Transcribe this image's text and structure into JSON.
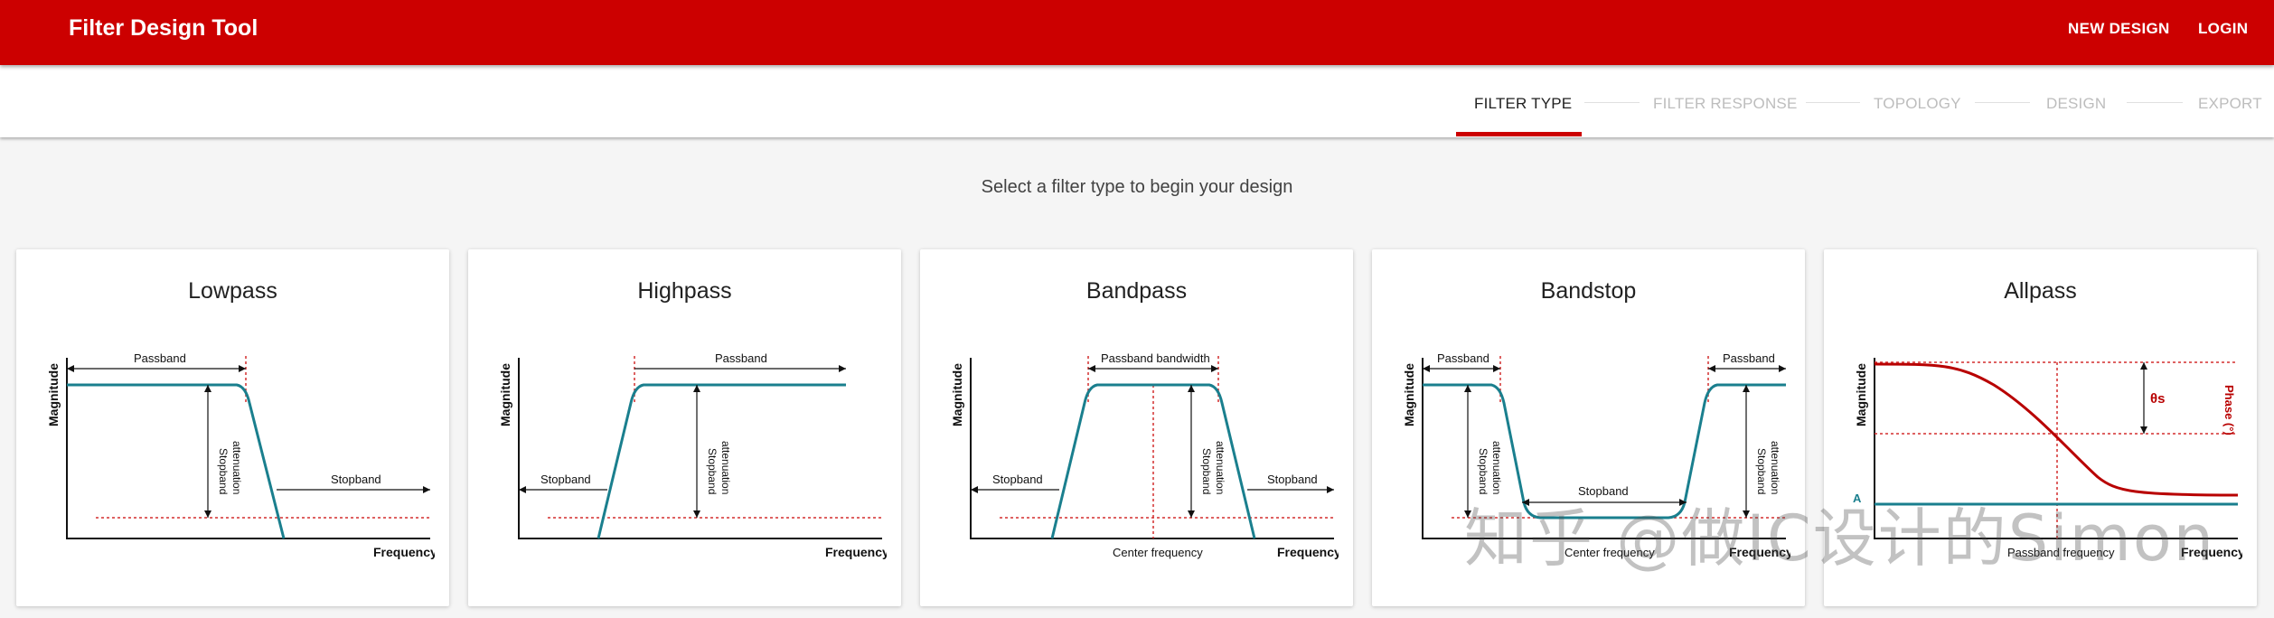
{
  "app": {
    "title": "Filter Design Tool",
    "actions": {
      "new_design": "NEW DESIGN",
      "login": "LOGIN"
    }
  },
  "stepper": {
    "steps": [
      {
        "label": "FILTER TYPE",
        "active": true
      },
      {
        "label": "FILTER RESPONSE",
        "active": false
      },
      {
        "label": "TOPOLOGY",
        "active": false
      },
      {
        "label": "DESIGN",
        "active": false
      },
      {
        "label": "EXPORT",
        "active": false
      }
    ]
  },
  "main": {
    "subtitle": "Select a filter type to begin your design",
    "cards": [
      {
        "title": "Lowpass",
        "labels": {
          "magnitude": "Magnitude",
          "frequency": "Frequency",
          "passband": "Passband",
          "stopband": "Stopband",
          "atten1": "Stopband",
          "atten2": "attenuation"
        }
      },
      {
        "title": "Highpass",
        "labels": {
          "magnitude": "Magnitude",
          "frequency": "Frequency",
          "passband": "Passband",
          "stopband": "Stopband",
          "atten1": "Stopband",
          "atten2": "attenuation"
        }
      },
      {
        "title": "Bandpass",
        "labels": {
          "magnitude": "Magnitude",
          "frequency": "Frequency",
          "passband_bw": "Passband bandwidth",
          "stopband": "Stopband",
          "atten1": "Stopband",
          "atten2": "attenuation",
          "center": "Center frequency"
        }
      },
      {
        "title": "Bandstop",
        "labels": {
          "magnitude": "Magnitude",
          "frequency": "Frequency",
          "passband": "Passband",
          "stopband": "Stopband",
          "atten1": "Stopband",
          "atten2": "attenuation",
          "center": "Center frequency"
        }
      },
      {
        "title": "Allpass",
        "labels": {
          "magnitude": "Magnitude",
          "frequency": "Frequency",
          "phase": "Phase (°)",
          "theta": "θs",
          "a_label": "A",
          "passband_freq": "Passband frequency"
        }
      }
    ]
  },
  "watermark": "知乎 @做IC设计的Simon",
  "colors": {
    "brand": "#cc0000",
    "curve_teal": "#1a7f8e",
    "curve_red": "#b80000",
    "guide_red": "#d32f2f"
  }
}
